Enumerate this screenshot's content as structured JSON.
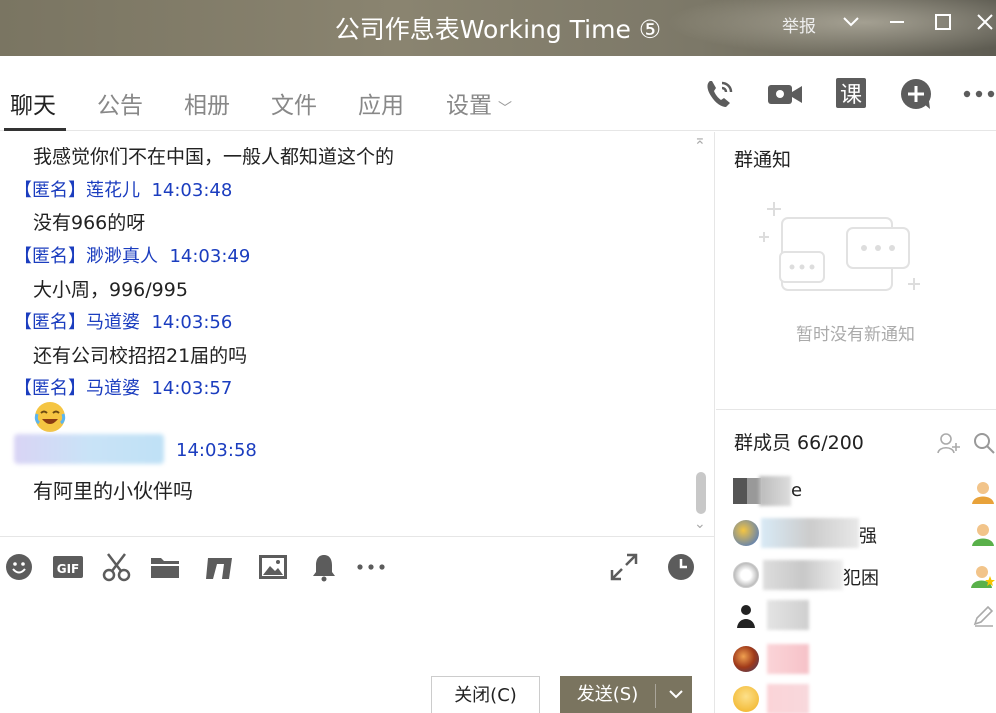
{
  "window": {
    "title": "公司作息表Working Time ⑤",
    "report_label": "举报",
    "controls": [
      "chevron-down-icon",
      "minimize-icon",
      "maximize-icon",
      "close-icon"
    ]
  },
  "tabs": [
    {
      "label": "聊天",
      "active": true
    },
    {
      "label": "公告",
      "active": false
    },
    {
      "label": "相册",
      "active": false
    },
    {
      "label": "文件",
      "active": false
    },
    {
      "label": "应用",
      "active": false
    },
    {
      "label": "设置",
      "active": false
    }
  ],
  "tab_tools": [
    "phone-call-icon",
    "video-call-icon",
    "lesson-icon",
    "add-icon",
    "more-icon"
  ],
  "lesson_glyph": "课",
  "chat": {
    "messages": [
      {
        "text": "我感觉你们不在中国，一般人都知道这个的"
      },
      {
        "sender": "【匿名】莲花儿",
        "time": "14:03:48",
        "text": "没有966的呀"
      },
      {
        "sender": "【匿名】渺渺真人",
        "time": "14:03:49",
        "text": "大小周，996/995"
      },
      {
        "sender": "【匿名】马道婆",
        "time": "14:03:56",
        "text": "还有公司校招招21届的吗"
      },
      {
        "sender": "【匿名】马道婆",
        "time": "14:03:57",
        "emoji": "laughing-tears-emoji"
      },
      {
        "sender_blurred": true,
        "time": "14:03:58",
        "text": "有阿里的小伙伴吗"
      }
    ]
  },
  "input_toolbar": [
    "smiley-icon",
    "gif-icon",
    "scissors-icon",
    "folder-icon",
    "gift-icon",
    "image-icon",
    "bell-icon",
    "more-icon",
    "expand-icon",
    "history-clock-icon"
  ],
  "gif_label": "GIF",
  "buttons": {
    "close": "关闭(C)",
    "send": "发送(S)"
  },
  "notice": {
    "title": "群通知",
    "empty": "暂时没有新通知"
  },
  "members": {
    "title": "群成员 66/200",
    "list": [
      {
        "visible_text": "e",
        "badge": "owner-user-icon"
      },
      {
        "visible_text": "强",
        "badge": "admin-user-icon"
      },
      {
        "visible_text": "犯困",
        "badge": "admin-star-user-icon"
      },
      {
        "visible_text": "",
        "badge": "edit-icon"
      },
      {
        "visible_text": "",
        "badge": ""
      },
      {
        "visible_text": "",
        "badge": ""
      }
    ]
  },
  "colors": {
    "accent": "#7a745f",
    "sender_blue": "#1b3dbf",
    "icon_gray": "#5c5c5c"
  }
}
